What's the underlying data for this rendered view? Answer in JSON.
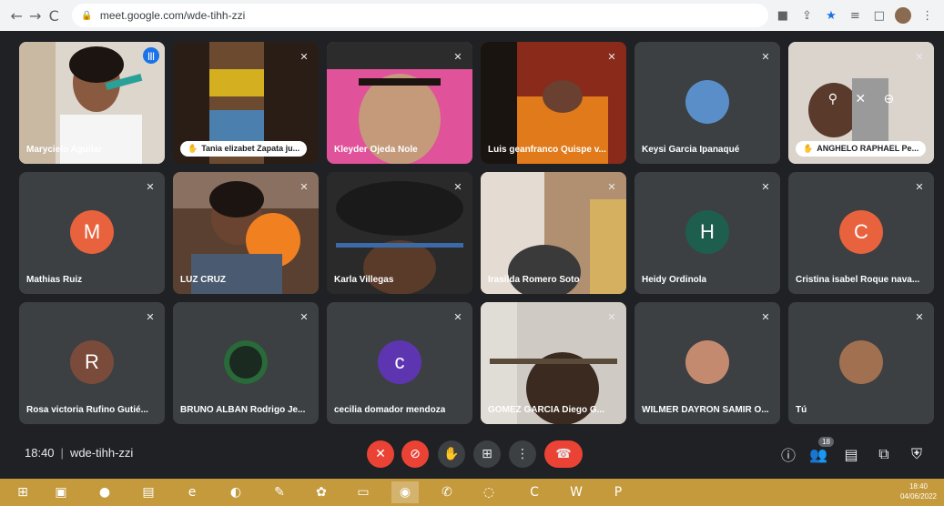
{
  "browser": {
    "url": "meet.google.com/wde-tihh-zzi",
    "back_icon": "←",
    "forward_icon": "→",
    "reload_icon": "C"
  },
  "participants": [
    {
      "name": "Marycielo Aguilar",
      "type": "video",
      "speaking": true
    },
    {
      "name": "Tania elizabet Zapata ju...",
      "type": "video",
      "raised_hand": true
    },
    {
      "name": "Kleyder Ojeda Nole",
      "type": "video"
    },
    {
      "name": "Luis geanfranco Quispe v...",
      "type": "video"
    },
    {
      "name": "Keysi Garcia Ipanaqué",
      "type": "photo"
    },
    {
      "name": "ANGHELO RAPHAEL Pe...",
      "type": "video",
      "raised_hand": true
    },
    {
      "name": "Mathias Ruiz",
      "type": "initial",
      "initial": "M",
      "color": "#e8623e"
    },
    {
      "name": "LUZ CRUZ",
      "type": "video"
    },
    {
      "name": "Karla Villegas",
      "type": "video"
    },
    {
      "name": "Irasilda Romero Soto",
      "type": "video"
    },
    {
      "name": "Heidy Ordinola",
      "type": "initial",
      "initial": "H",
      "color": "#1e5e4e"
    },
    {
      "name": "Cristina isabel Roque nava...",
      "type": "initial",
      "initial": "C",
      "color": "#e8623e"
    },
    {
      "name": "Rosa victoria Rufino Gutié...",
      "type": "initial",
      "initial": "R",
      "color": "#7a4b3a"
    },
    {
      "name": "BRUNO ALBAN Rodrigo Je...",
      "type": "photo"
    },
    {
      "name": "cecilia domador mendoza",
      "type": "initial",
      "initial": "c",
      "color": "#5e35b1"
    },
    {
      "name": "GOMEZ GARCIA Diego G...",
      "type": "video"
    },
    {
      "name": "WILMER DAYRON SAMIR O...",
      "type": "photo"
    },
    {
      "name": "Tú",
      "type": "photo"
    }
  ],
  "footer": {
    "time": "18:40",
    "meeting_code": "wde-tihh-zzi",
    "people_count": "18"
  },
  "taskbar": {
    "time": "18:40",
    "date": "04/06/2022"
  }
}
